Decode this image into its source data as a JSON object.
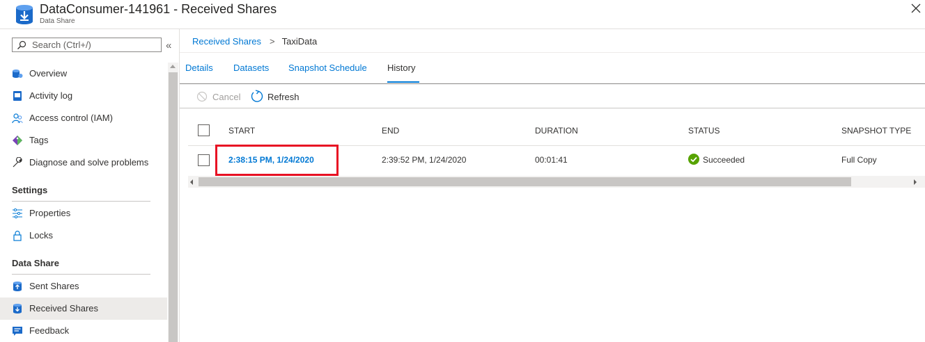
{
  "header": {
    "title": "DataConsumer-141961 - Received Shares",
    "subtitle": "Data Share",
    "icon": "data-share-icon",
    "close_icon": "close-icon"
  },
  "sidebar": {
    "search": {
      "placeholder": "Search (Ctrl+/)",
      "value": ""
    },
    "collapse_glyph": "«",
    "items_top": [
      {
        "label": "Overview",
        "icon": "overview-icon"
      },
      {
        "label": "Activity log",
        "icon": "activity-log-icon"
      },
      {
        "label": "Access control (IAM)",
        "icon": "people-icon"
      },
      {
        "label": "Tags",
        "icon": "tag-icon"
      },
      {
        "label": "Diagnose and solve problems",
        "icon": "wrench-icon"
      }
    ],
    "settings_header": "Settings",
    "items_settings": [
      {
        "label": "Properties",
        "icon": "properties-icon"
      },
      {
        "label": "Locks",
        "icon": "lock-icon"
      }
    ],
    "datashare_header": "Data Share",
    "items_datashare": [
      {
        "label": "Sent Shares",
        "icon": "sent-shares-icon"
      },
      {
        "label": "Received Shares",
        "icon": "received-shares-icon",
        "active": true
      },
      {
        "label": "Feedback",
        "icon": "feedback-icon"
      }
    ]
  },
  "breadcrumb": {
    "link": "Received Shares",
    "separator": ">",
    "current": "TaxiData"
  },
  "tabs": [
    {
      "label": "Details"
    },
    {
      "label": "Datasets"
    },
    {
      "label": "Snapshot Schedule"
    },
    {
      "label": "History",
      "active": true
    }
  ],
  "toolbar": {
    "cancel_label": "Cancel",
    "refresh_label": "Refresh"
  },
  "table": {
    "headers": [
      "START",
      "END",
      "DURATION",
      "STATUS",
      "SNAPSHOT TYPE"
    ],
    "rows": [
      {
        "start": "2:38:15 PM, 1/24/2020",
        "end": "2:39:52 PM, 1/24/2020",
        "duration": "00:01:41",
        "status": "Succeeded",
        "snapshot_type": "Full Copy"
      }
    ]
  },
  "colors": {
    "accent": "#0078d4",
    "success": "#57a300",
    "highlight": "#e81123"
  }
}
